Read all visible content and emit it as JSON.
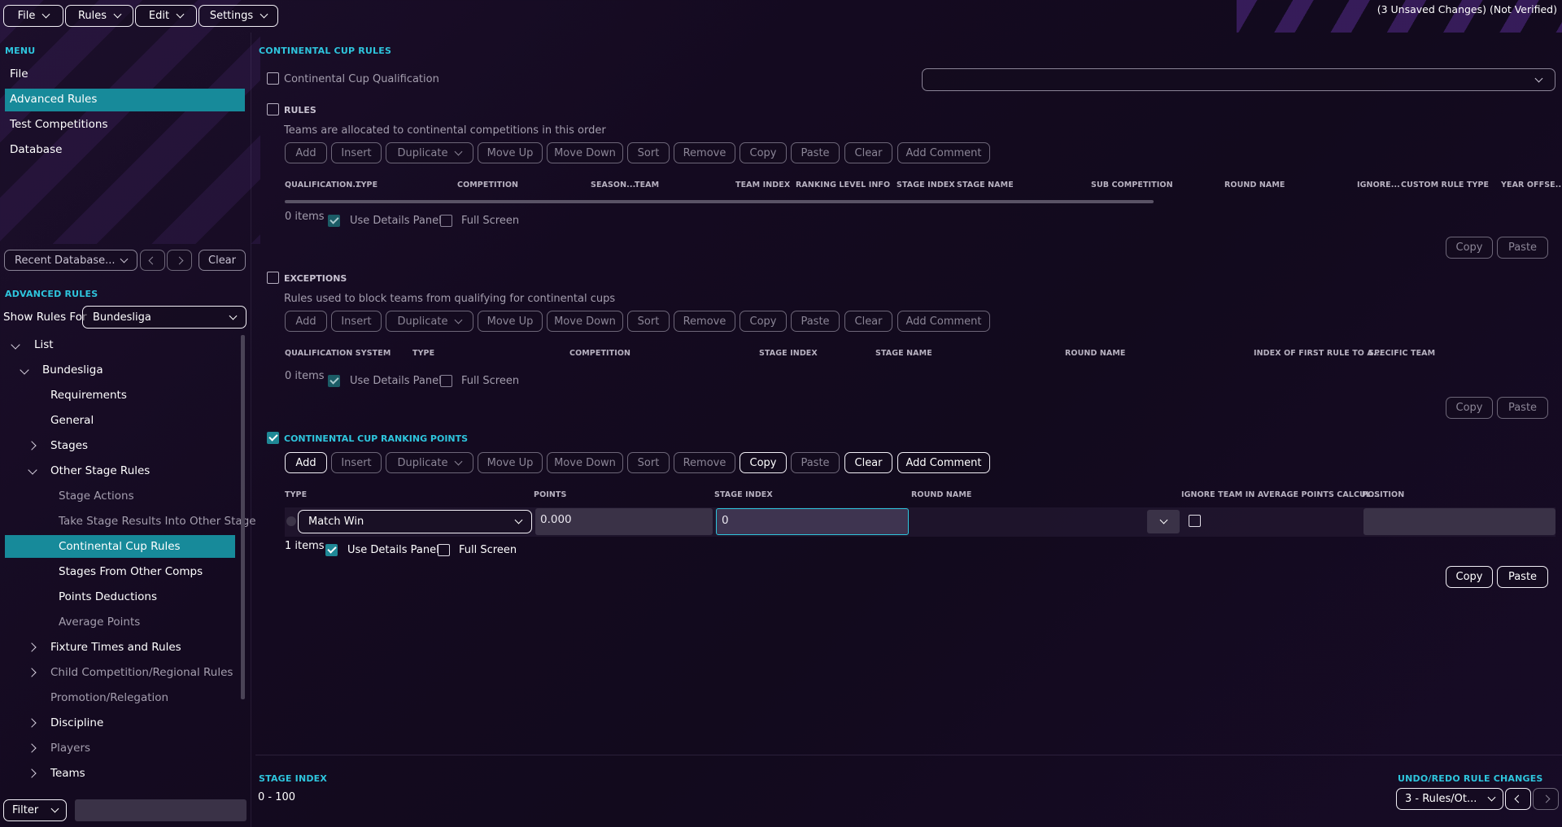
{
  "topbar": {
    "menus": [
      "File",
      "Rules",
      "Edit",
      "Settings"
    ],
    "status": "(3 Unsaved Changes) (Not Verified)"
  },
  "sidebar": {
    "menu_title": "MENU",
    "menu_items": [
      "File",
      "Advanced Rules",
      "Test Competitions",
      "Database"
    ],
    "recent_db": "Recent Database...",
    "clear": "Clear",
    "adv_title": "ADVANCED RULES",
    "show_rules_for_label": "Show Rules For",
    "show_rules_for_value": "Bundesliga",
    "tree": {
      "list": "List",
      "bundesliga": "Bundesliga",
      "requirements": "Requirements",
      "general": "General",
      "stages": "Stages",
      "other_stage_rules": "Other Stage Rules",
      "stage_actions": "Stage Actions",
      "take_stage_results": "Take Stage Results Into Other Stage",
      "continental_cup_rules": "Continental Cup Rules",
      "stages_from_other_comps": "Stages From Other Comps",
      "points_deductions": "Points Deductions",
      "average_points": "Average Points",
      "fixture_times": "Fixture Times and Rules",
      "child_competition": "Child Competition/Regional Rules",
      "promotion_relegation": "Promotion/Relegation",
      "discipline": "Discipline",
      "players": "Players",
      "teams": "Teams"
    },
    "filter": "Filter"
  },
  "main": {
    "title": "CONTINENTAL CUP RULES",
    "qualification_label": "Continental Cup Qualification",
    "toolbar": {
      "add": "Add",
      "insert": "Insert",
      "duplicate": "Duplicate",
      "move_up": "Move Up",
      "move_down": "Move Down",
      "sort": "Sort",
      "remove": "Remove",
      "copy": "Copy",
      "paste": "Paste",
      "clear": "Clear",
      "add_comment": "Add Comment"
    },
    "use_details_panel": "Use Details Panel",
    "full_screen": "Full Screen",
    "rules": {
      "heading": "RULES",
      "desc": "Teams are allocated to continental competitions in this order",
      "columns": [
        "QUALIFICATION...",
        "TYPE",
        "COMPETITION",
        "SEASON...",
        "TEAM",
        "TEAM INDEX",
        "RANKING LEVEL INFO",
        "STAGE INDEX",
        "STAGE NAME",
        "SUB COMPETITION",
        "ROUND NAME",
        "IGNORE...",
        "CUSTOM RULE TYPE",
        "YEAR OFFSE..."
      ],
      "count": "0 items"
    },
    "exceptions": {
      "heading": "EXCEPTIONS",
      "desc": "Rules used to block teams from qualifying for continental cups",
      "columns": [
        "QUALIFICATION SYSTEM",
        "TYPE",
        "COMPETITION",
        "STAGE INDEX",
        "STAGE NAME",
        "ROUND NAME",
        "INDEX OF FIRST RULE TO A...",
        "SPECIFIC TEAM"
      ],
      "count": "0 items"
    },
    "ranking": {
      "heading": "CONTINENTAL CUP RANKING POINTS",
      "columns": [
        "TYPE",
        "POINTS",
        "STAGE INDEX",
        "ROUND NAME",
        "IGNORE TEAM IN AVERAGE POINTS CALCUL...",
        "POSITION"
      ],
      "row": {
        "type": "Match Win",
        "points": "0.000",
        "stage_index": "0"
      },
      "count": "1 items"
    }
  },
  "footer": {
    "stage_index_title": "STAGE INDEX",
    "stage_index_range": "0 - 100",
    "undo_title": "UNDO/REDO RULE CHANGES",
    "undo_value": "3 - Rules/Ot..."
  },
  "colors": {
    "accent": "#2ec5dd",
    "selected": "#178a9a",
    "background": "#160c22"
  }
}
